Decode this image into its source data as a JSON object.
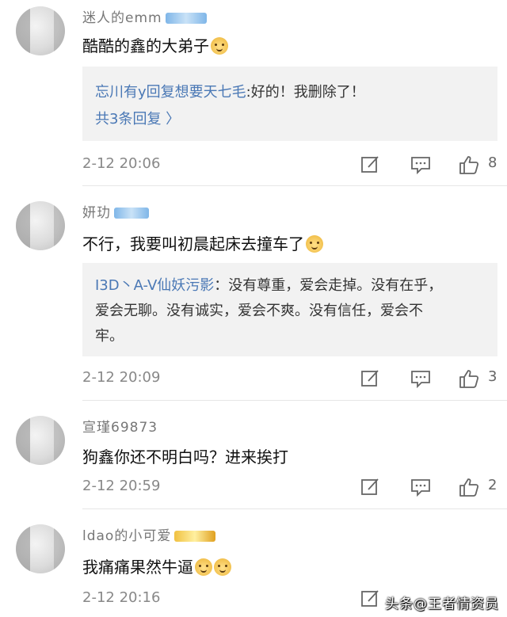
{
  "comments": [
    {
      "username": "迷人的emm",
      "text": "酷酷的鑫的大弟子",
      "reply": {
        "user": "忘川有y回复",
        "blurred": "想要天七毛",
        "text": ":好的！我删除了！",
        "more": "共3条回复 〉"
      },
      "time": "2-12 20:06",
      "like_count": "8"
    },
    {
      "username": "妍玏",
      "text": "不行，我要叫初晨起床去撞车了",
      "reply": {
        "user": "I3D丶A-V仙妖污影",
        "text_line1": "：没有尊重，爱会走掉。没有在乎，",
        "text_line2": "爱会无聊。没有诚实，爱会不爽。没有信任，爱会不",
        "text_line3": "牢。"
      },
      "time": "2-12 20:09",
      "like_count": "3"
    },
    {
      "username": "宣瑾69873",
      "text": "狗鑫你还不明白吗？进来挨打",
      "time": "2-12 20:59",
      "like_count": "2"
    },
    {
      "username": "ldao的小可爱",
      "text": "我痛痛果然牛逼",
      "time": "2-12 20:16",
      "like_count": ""
    }
  ],
  "icons": {
    "edit": "edit-icon",
    "comment": "comment-icon",
    "like": "thumbs-up-icon"
  },
  "watermark": "头条@王者情资员"
}
